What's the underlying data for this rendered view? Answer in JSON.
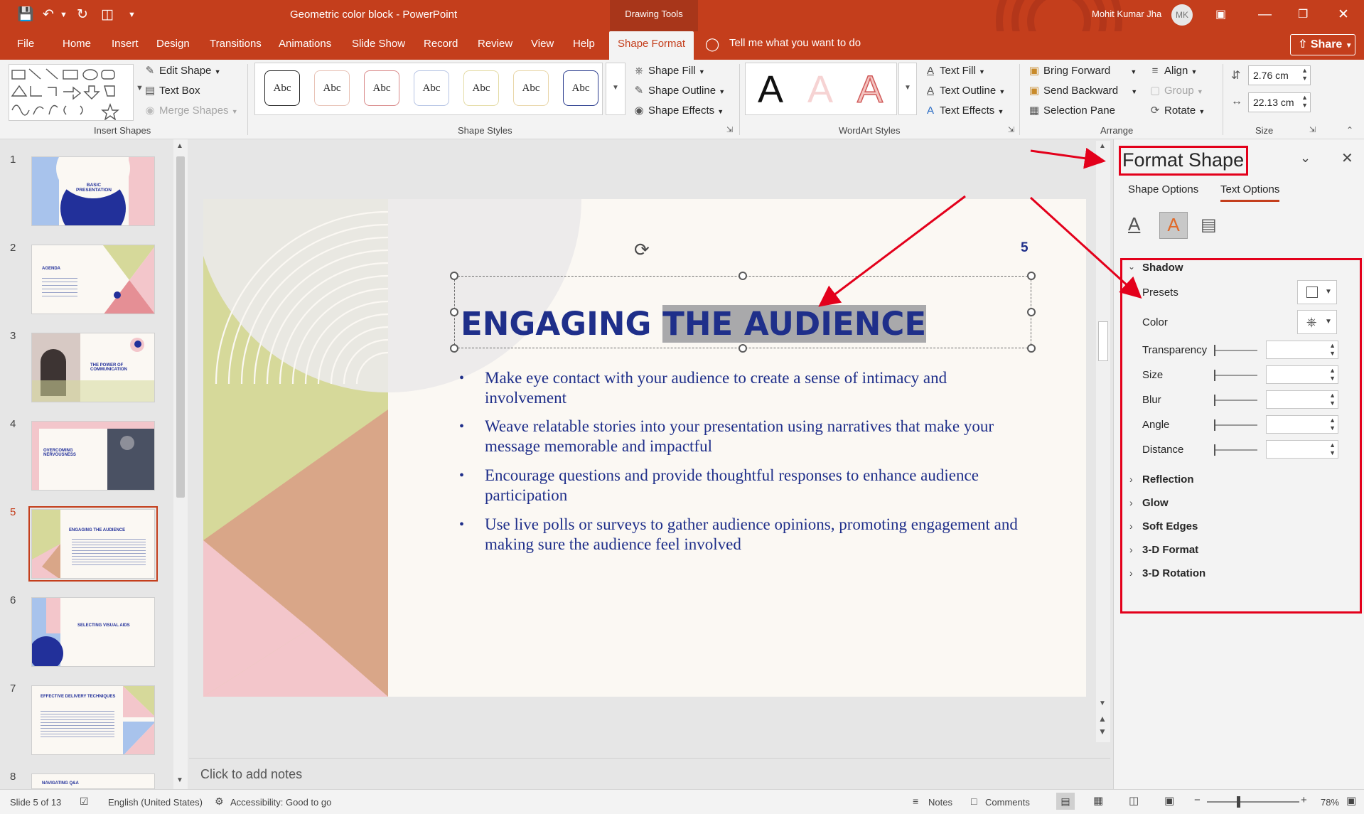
{
  "title_bar": {
    "document_title": "Geometric color block",
    "app_sep": "-",
    "app_name": "PowerPoint",
    "contextual_group": "Drawing Tools",
    "user_name": "Mohit Kumar Jha",
    "user_initials": "MK"
  },
  "tabs": [
    "File",
    "Home",
    "Insert",
    "Design",
    "Transitions",
    "Animations",
    "Slide Show",
    "Record",
    "Review",
    "View",
    "Help",
    "Shape Format"
  ],
  "tell_me": "Tell me what you want to do",
  "share_label": "Share",
  "ribbon": {
    "insert_shapes": {
      "edit_shape": "Edit Shape",
      "text_box": "Text Box",
      "merge_shapes": "Merge Shapes",
      "label": "Insert Shapes"
    },
    "shape_styles": {
      "sample": "Abc",
      "shape_fill": "Shape Fill",
      "shape_outline": "Shape Outline",
      "shape_effects": "Shape Effects",
      "label": "Shape Styles"
    },
    "wordart": {
      "letter": "A",
      "text_fill": "Text Fill",
      "text_outline": "Text Outline",
      "text_effects": "Text Effects",
      "label": "WordArt Styles"
    },
    "arrange": {
      "bring_forward": "Bring Forward",
      "send_backward": "Send Backward",
      "selection_pane": "Selection Pane",
      "align": "Align",
      "group": "Group",
      "rotate": "Rotate",
      "label": "Arrange"
    },
    "size": {
      "height": "2.76 cm",
      "width": "22.13 cm",
      "label": "Size"
    }
  },
  "thumbnails": [
    {
      "num": "1",
      "text": "BASIC PRESENTATION"
    },
    {
      "num": "2",
      "text": "AGENDA"
    },
    {
      "num": "3",
      "text": "THE POWER OF COMMUNICATION"
    },
    {
      "num": "4",
      "text": "OVERCOMING NERVOUSNESS"
    },
    {
      "num": "5",
      "text": "ENGAGING THE AUDIENCE"
    },
    {
      "num": "6",
      "text": "SELECTING VISUAL AIDS"
    },
    {
      "num": "7",
      "text": "EFFECTIVE DELIVERY TECHNIQUES"
    },
    {
      "num": "8",
      "text": "NAVIGATING Q&A"
    }
  ],
  "slide": {
    "page_number": "5",
    "title_part1": "ENGAGING",
    "title_part2": "THE AUDIENCE",
    "bullets": [
      "Make eye contact with your audience to create a sense of intimacy and involvement",
      "Weave relatable stories into your presentation using narratives that make your message memorable and impactful",
      "Encourage questions and provide thoughtful responses to enhance audience participation",
      "Use live polls or surveys to gather audience opinions, promoting engagement and making sure the audience feel involved"
    ]
  },
  "notes_placeholder": "Click to add notes",
  "format_pane": {
    "title": "Format Shape",
    "tabs": [
      "Shape Options",
      "Text Options"
    ],
    "shadow_label": "Shadow",
    "shadow_fields": [
      "Presets",
      "Color",
      "Transparency",
      "Size",
      "Blur",
      "Angle",
      "Distance"
    ],
    "sections": [
      "Reflection",
      "Glow",
      "Soft Edges",
      "3-D Format",
      "3-D Rotation"
    ]
  },
  "status_bar": {
    "slide_info": "Slide 5 of 13",
    "language": "English (United States)",
    "accessibility": "Accessibility: Good to go",
    "notes": "Notes",
    "comments": "Comments",
    "zoom": "78%"
  },
  "colors": {
    "accent": "#c43e1c",
    "slide_title": "#1f2f8a",
    "highlight": "#e3001b"
  }
}
